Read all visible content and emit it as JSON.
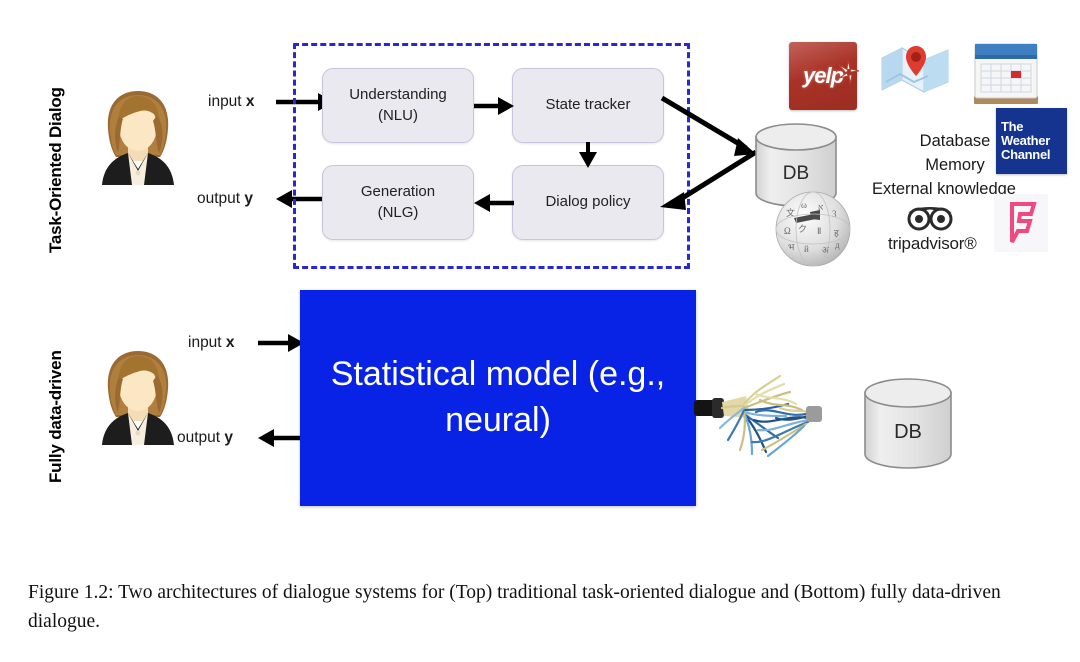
{
  "figure": {
    "caption": "Figure 1.2: Two architectures of dialogue systems for (Top) traditional task-oriented dialogue and (Bottom) fully data-driven dialogue.",
    "background_color": "#ffffff"
  },
  "rows": [
    {
      "id": "top",
      "label": "Task-Oriented Dialog"
    },
    {
      "id": "bottom",
      "label": "Fully data-driven"
    }
  ],
  "top_row": {
    "io": {
      "input_prefix": "input ",
      "input_var": "x",
      "output_prefix": "output ",
      "output_var": "y"
    },
    "dashed_border_color": "#2727d4",
    "modules": [
      {
        "id": "nlu",
        "line1": "Understanding",
        "line2": "(NLU)"
      },
      {
        "id": "state-tracker",
        "line1": "State tracker",
        "line2": ""
      },
      {
        "id": "dialog-policy",
        "line1": "Dialog policy",
        "line2": ""
      },
      {
        "id": "nlg",
        "line1": "Generation",
        "line2": "(NLG)"
      }
    ],
    "database": {
      "label": "DB"
    },
    "knowledge_sources": {
      "lines": [
        "Database",
        "Memory",
        "External knowledge"
      ],
      "logos": [
        {
          "id": "yelp",
          "name": "yelp-logo",
          "text": "yelp",
          "color": "#a93226"
        },
        {
          "id": "maps",
          "name": "maps-logo",
          "text": "",
          "color": "#bcd9ef"
        },
        {
          "id": "calendar",
          "name": "calendar-logo",
          "text": "",
          "color": "#3f7fc1"
        },
        {
          "id": "weather-channel",
          "name": "weather-channel-logo",
          "text": "The Weather Channel",
          "color": "#14348f"
        },
        {
          "id": "wikipedia",
          "name": "wikipedia-globe-logo",
          "text": "",
          "color": "#bdbdbd"
        },
        {
          "id": "tripadvisor",
          "name": "tripadvisor-logo",
          "text": "tripadvisor®",
          "color": "#1d1d1d"
        },
        {
          "id": "foursquare",
          "name": "foursquare-logo",
          "text": "",
          "color": "#f0497f"
        }
      ]
    }
  },
  "bottom_row": {
    "io": {
      "input_prefix": "input ",
      "input_var": "x",
      "output_prefix": "output ",
      "output_var": "y"
    },
    "model_box": {
      "line1": "Statistical model",
      "line2": "(e.g., neural)",
      "fill_color": "#0923e6",
      "text_color": "#ffffff"
    },
    "database": {
      "label": "DB"
    },
    "cable": {
      "name": "frayed-cable"
    }
  }
}
